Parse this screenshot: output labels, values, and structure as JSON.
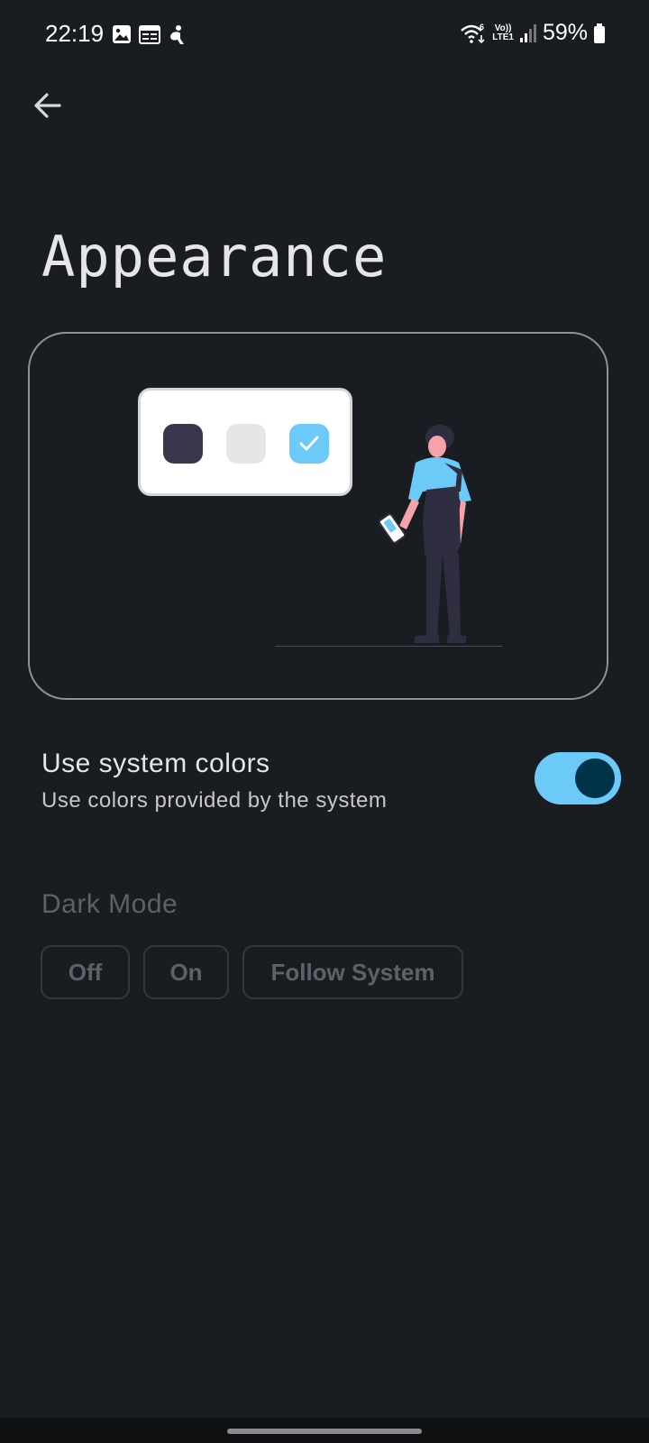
{
  "status_bar": {
    "time": "22:19",
    "battery": "59%",
    "lte_top": "Vo))",
    "lte_bottom": "LTE1",
    "icons": [
      "gallery-icon",
      "calendar-icon",
      "accessibility-icon",
      "wifi-6-icon",
      "volte-icon",
      "signal-icon",
      "battery-icon"
    ]
  },
  "header": {
    "back_icon": "arrow-back-icon",
    "title": "Appearance"
  },
  "illustration": {
    "swatches": [
      "dark",
      "light",
      "accent-selected"
    ],
    "colors": {
      "dark": "#3a374d",
      "light": "#e6e6e6",
      "accent": "#6ccaf8"
    }
  },
  "system_colors": {
    "title": "Use system colors",
    "subtitle": "Use colors provided by the system",
    "enabled": true
  },
  "dark_mode": {
    "label": "Dark Mode",
    "options": [
      "Off",
      "On",
      "Follow System"
    ]
  },
  "theme": {
    "background": "#191c20",
    "accent": "#6ccaf8",
    "toggle_knob": "#003549"
  }
}
